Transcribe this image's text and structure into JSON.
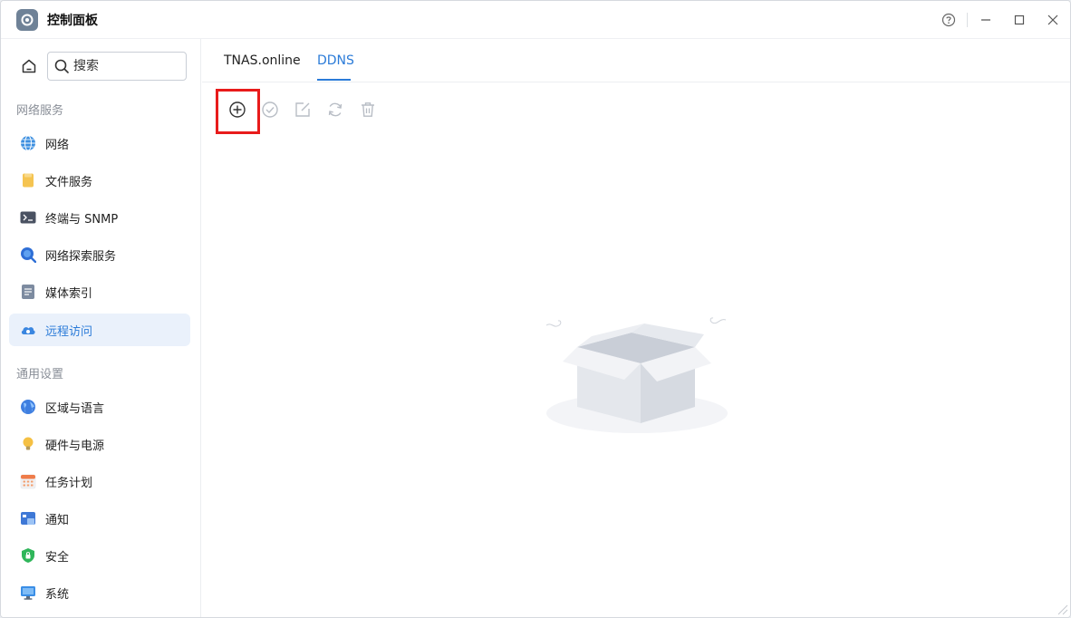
{
  "window": {
    "title": "控制面板",
    "icons": [
      "gear-icon",
      "help-icon",
      "minimize-icon",
      "maximize-icon",
      "close-icon"
    ]
  },
  "sidebar": {
    "search": {
      "placeholder": "搜索"
    },
    "sections": [
      {
        "label": "网络服务"
      },
      {
        "label": "通用设置"
      }
    ],
    "items": [
      {
        "label": "网络",
        "icon": "globe-icon",
        "active": false
      },
      {
        "label": "文件服务",
        "icon": "folder-icon",
        "active": false
      },
      {
        "label": "终端与 SNMP",
        "icon": "terminal-icon",
        "active": false
      },
      {
        "label": "网络探索服务",
        "icon": "search-magnifier-icon",
        "active": false
      },
      {
        "label": "媒体索引",
        "icon": "media-index-icon",
        "active": false
      },
      {
        "label": "远程访问",
        "icon": "cloud-icon",
        "active": true
      },
      {
        "label": "区域与语言",
        "icon": "region-globe-icon",
        "active": false
      },
      {
        "label": "硬件与电源",
        "icon": "lightbulb-icon",
        "active": false
      },
      {
        "label": "任务计划",
        "icon": "calendar-icon",
        "active": false
      },
      {
        "label": "通知",
        "icon": "notification-icon",
        "active": false
      },
      {
        "label": "安全",
        "icon": "shield-icon",
        "active": false
      },
      {
        "label": "系统",
        "icon": "monitor-icon",
        "active": false
      }
    ]
  },
  "main": {
    "tabs": [
      {
        "label": "TNAS.online",
        "active": false
      },
      {
        "label": "DDNS",
        "active": true
      }
    ],
    "toolbar": [
      {
        "name": "add",
        "icon": "plus-circle-icon",
        "enabled": true
      },
      {
        "name": "enable",
        "icon": "check-circle-icon",
        "enabled": false
      },
      {
        "name": "edit",
        "icon": "edit-icon",
        "enabled": false
      },
      {
        "name": "refresh",
        "icon": "refresh-icon",
        "enabled": false
      },
      {
        "name": "delete",
        "icon": "trash-icon",
        "enabled": false
      }
    ],
    "empty_state": {
      "icon": "empty-box-icon"
    }
  },
  "colors": {
    "accent": "#2b7bd8",
    "active_bg": "#eaf1fb",
    "highlight": "#e81b1b",
    "disabled_icon": "#b8bdc5"
  }
}
